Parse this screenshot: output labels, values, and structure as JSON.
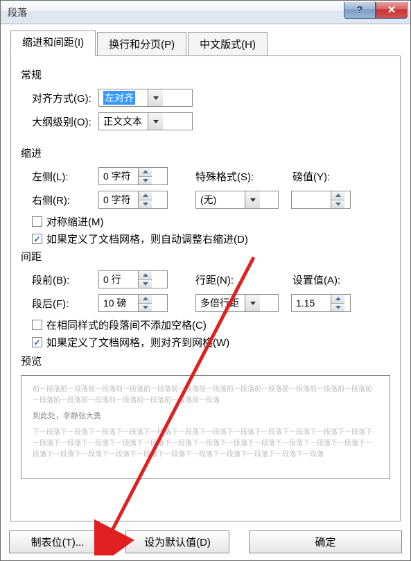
{
  "title": "段落",
  "tabs": {
    "indent": "缩进和间距(I)",
    "pagination": "换行和分页(P)",
    "asian": "中文版式(H)"
  },
  "sections": {
    "general": "常规",
    "indent": "缩进",
    "spacing": "间距",
    "preview": "预览"
  },
  "labels": {
    "alignment": "对齐方式(G):",
    "outline": "大纲级别(O):",
    "left": "左侧(L):",
    "right": "右侧(R):",
    "special": "特殊格式(S):",
    "by": "磅值(Y):",
    "before": "段前(B):",
    "after": "段后(F):",
    "lineSpacing": "行距(N):",
    "at": "设置值(A):"
  },
  "values": {
    "alignment": "左对齐",
    "outline": "正文文本",
    "left": "0 字符",
    "right": "0 字符",
    "special": "(无)",
    "by": "",
    "before": "0 行",
    "after": "10 磅",
    "lineSpacing": "多倍行距",
    "at": "1.15"
  },
  "checks": {
    "mirror": "对称缩进(M)",
    "autoAdjustRight": "如果定义了文档网格，则自动调整右缩进(D)",
    "noSpaceSameStyle": "在相同样式的段落间不添加空格(C)",
    "snapGrid": "如果定义了文档网格，则对齐到网格(W)"
  },
  "checkState": {
    "mirror": false,
    "autoAdjustRight": true,
    "noSpaceSameStyle": false,
    "snapGrid": true
  },
  "preview": {
    "filler_before": "前一段落前一段落前一段落前一段落前一段落前一段落前一段落前一段落前一段落前一段落前一段落前一段落前一段落前一段落前一段落前一段落前一段落前一段落前一段落",
    "sample": "到此处，李静张大勇",
    "filler_after": "下一段落下一段落下一段落下一段落下一段落下一段落下一段落下一段落下一段落下一段落下一段落下一段落下一段落下一段落下一段落下一段落下一段落下一段落下一段落下一段落下一段落下一段落下一段落下一段落下一段落下一段落下一段落下一段落下一段落下一段落下一段落下一段落下一段落下一段落下一段落"
  },
  "buttons": {
    "tabs": "制表位(T)...",
    "default": "设为默认值(D)",
    "ok": "确定"
  }
}
